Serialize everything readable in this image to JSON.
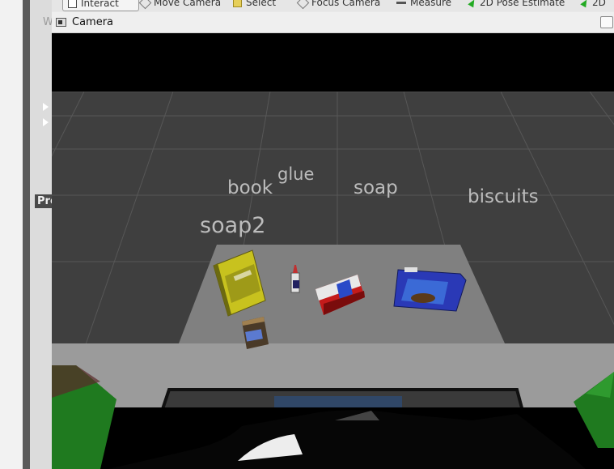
{
  "toolbar": {
    "tools": [
      {
        "label": "Interact",
        "icon": "interact-icon"
      },
      {
        "label": "Move Camera",
        "icon": "move-camera-icon"
      },
      {
        "label": "Select",
        "icon": "select-icon"
      },
      {
        "label": "Focus Camera",
        "icon": "focus-camera-icon"
      },
      {
        "label": "Measure",
        "icon": "measure-icon"
      },
      {
        "label": "2D Pose Estimate",
        "icon": "pose-estimate-icon",
        "color": "#22aa22"
      },
      {
        "label": "2D",
        "icon": "nav-goal-icon",
        "color": "#22aa22"
      }
    ]
  },
  "left_panel": {
    "w_label": "W",
    "pr_label": "Pro"
  },
  "camera_panel": {
    "title": "Camera",
    "icon": "camera-icon"
  },
  "scene": {
    "labels": [
      "book",
      "glue",
      "soap",
      "biscuits",
      "soap2"
    ],
    "objects": [
      {
        "name": "book",
        "color": "#c8c21e"
      },
      {
        "name": "glue",
        "color": "#d8d8d8"
      },
      {
        "name": "soap",
        "color": "#c41b1b"
      },
      {
        "name": "biscuits",
        "color": "#2a39b6"
      },
      {
        "name": "soap2",
        "color": "#4a3a28"
      }
    ],
    "colors": {
      "grid_floor": "#3f3f3f",
      "grid_lines": "#5a5a5a",
      "table_top": "#808080",
      "front_floor": "#9b9b9b",
      "bin_green": "#1f7a1f",
      "background": "#000000"
    }
  }
}
